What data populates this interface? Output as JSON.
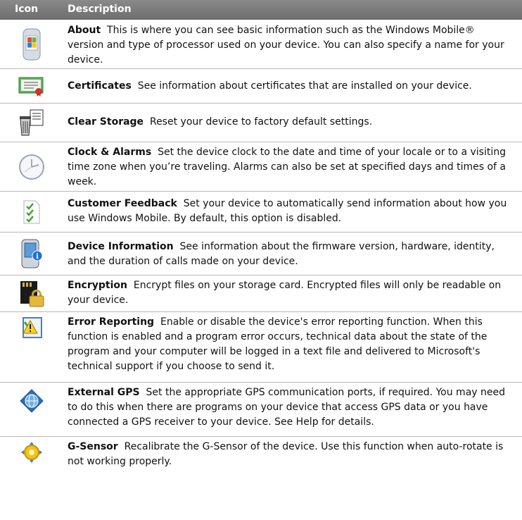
{
  "header": {
    "icon_label": "Icon",
    "description_label": "Description"
  },
  "rows": [
    {
      "icon": "about-icon",
      "title": "About",
      "text": "This is where you can see basic information such as the Windows Mobile® version and type of processor used on your device. You can also specify a name for your device."
    },
    {
      "icon": "certificates-icon",
      "title": "Certificates",
      "text": "See information about certificates that are installed on your device."
    },
    {
      "icon": "clear-storage-icon",
      "title": "Clear Storage",
      "text": "Reset your device to factory default settings."
    },
    {
      "icon": "clock-icon",
      "title": "Clock & Alarms",
      "text": "Set the device clock to the date and time of your locale or to a visiting time zone when you’re traveling. Alarms can also be set at specified days and times of a week."
    },
    {
      "icon": "customer-feedback-icon",
      "title": "Customer Feedback",
      "text": "Set your device to automatically send information about how you use Windows Mobile. By default, this option is disabled."
    },
    {
      "icon": "device-information-icon",
      "title": "Device Information",
      "text": "See information about the firmware version, hardware, identity, and the duration of calls made on your device."
    },
    {
      "icon": "encryption-icon",
      "title": "Encryption",
      "text": "Encrypt files on your storage card. Encrypted files will only be readable on your device."
    },
    {
      "icon": "error-reporting-icon",
      "title": "Error Reporting",
      "text": "Enable or disable the device's error reporting function. When this function is enabled and a program error occurs, technical data about the state of the program and your computer will be logged in a text file and delivered to Microsoft's technical support if you choose to send it."
    },
    {
      "icon": "external-gps-icon",
      "title": "External GPS",
      "text": "Set the appropriate GPS communication ports, if required. You may need to do this when there are programs on your device that access GPS data or you have connected a GPS receiver to your device. See Help for details."
    },
    {
      "icon": "g-sensor-icon",
      "title": "G-Sensor",
      "text": "Recalibrate the G-Sensor of the device. Use this function when auto-rotate is not working properly."
    }
  ]
}
